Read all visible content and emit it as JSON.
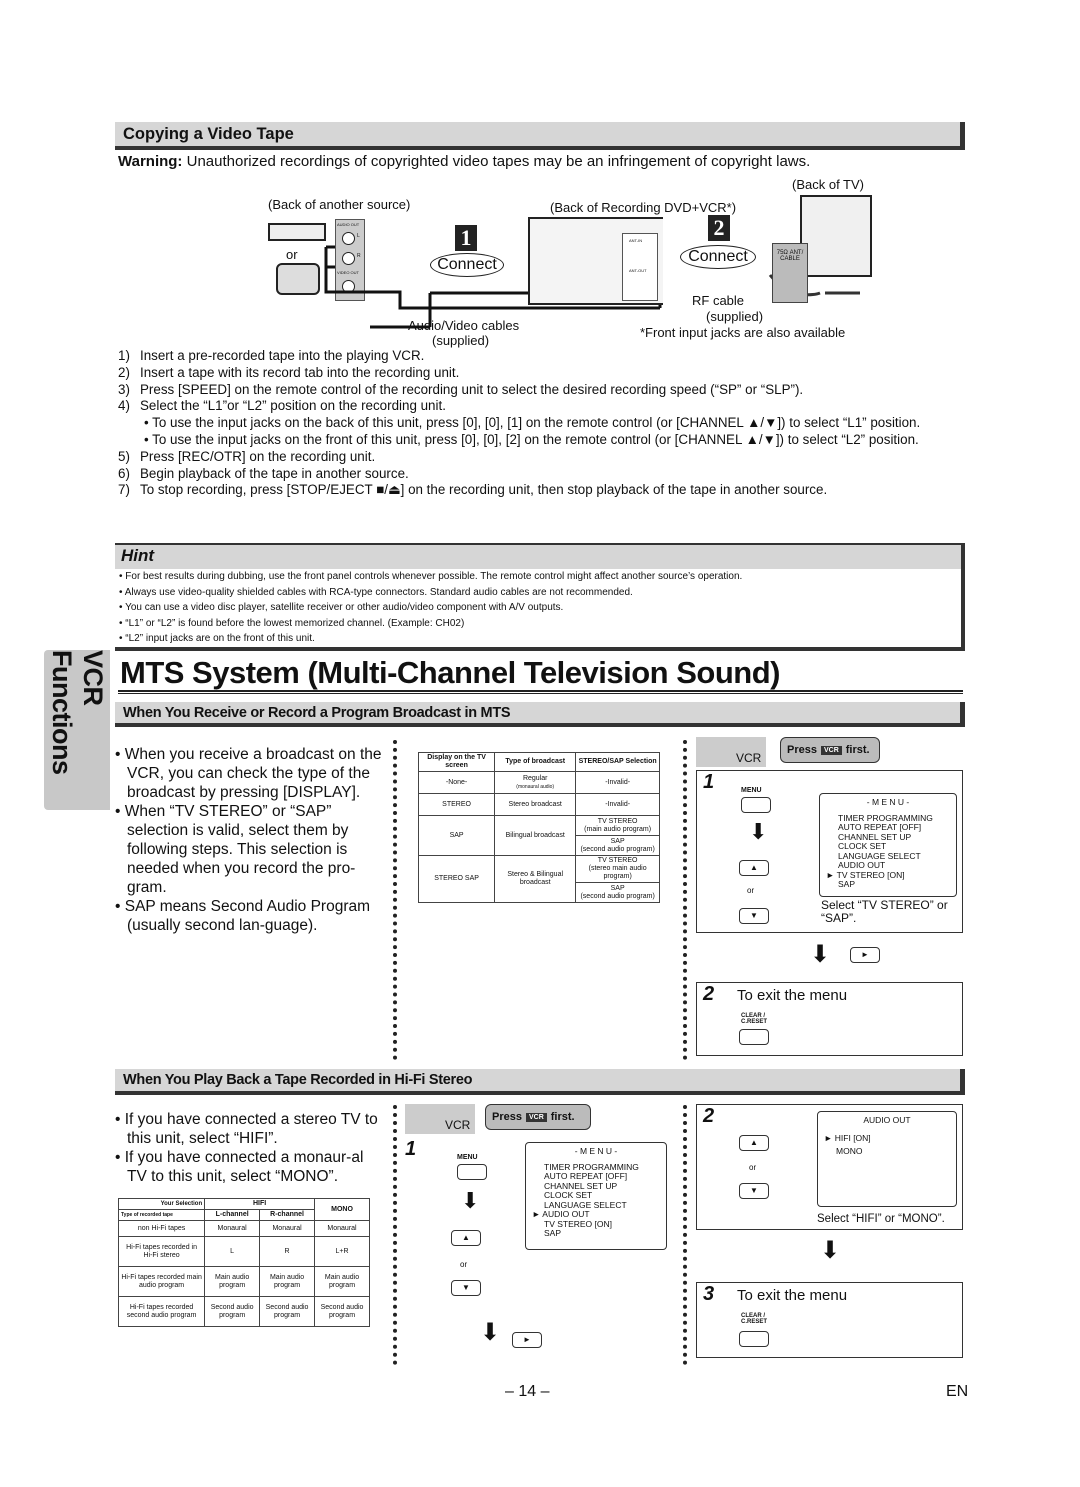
{
  "side_tab": "VCR Functions",
  "copy": {
    "title": "Copying a Video Tape",
    "warning_label": "Warning:",
    "warning_text": " Unauthorized recordings of copyrighted video tapes may be an infringement of copyright laws.",
    "diagram": {
      "back_source": "(Back of another source)",
      "or": "or",
      "audio_out": "AUDIO OUT",
      "l": "L",
      "r": "R",
      "video_out": "VIDEO OUT",
      "connect1_num": "1",
      "connect1": "Connect",
      "av_cables": "Audio/Video cables",
      "supplied": "(supplied)",
      "back_recording": "(Back of Recording DVD+VCR*)",
      "ant_in": "ANT-IN",
      "ant_out": "ANT-OUT",
      "connect2_num": "2",
      "connect2": "Connect",
      "rf_cable": "RF cable",
      "rf_supplied": "(supplied)",
      "back_tv": "(Back of TV)",
      "ant_cable": "75Ω ANT/ CABLE",
      "front_note": "*Front input jacks are also available"
    },
    "steps": [
      {
        "n": "1)",
        "t": "Insert a pre-recorded tape into the playing VCR."
      },
      {
        "n": "2)",
        "t": "Insert a tape with its record tab into the recording unit."
      },
      {
        "n": "3)",
        "t": "Press [SPEED] on the remote control of the recording unit to select the desired recording speed (“SP” or “SLP”)."
      },
      {
        "n": "4)",
        "t": "Select the “L1”or “L2” position on the recording unit."
      },
      {
        "n": "",
        "t": "• To use the input jacks on the back of this unit, press [0], [0], [1] on the remote control (or [CHANNEL ▲/▼]) to select “L1” position."
      },
      {
        "n": "",
        "t": "• To use the input jacks on the front of this unit, press [0], [0], [2] on the remote control (or [CHANNEL ▲/▼]) to select “L2” position."
      },
      {
        "n": "5)",
        "t": "Press [REC/OTR] on the recording unit."
      },
      {
        "n": "6)",
        "t": "Begin playback of the tape in another source."
      },
      {
        "n": "7)",
        "t": "To stop recording, press [STOP/EJECT ■/⏏] on the recording unit, then stop playback of the tape in another source."
      }
    ]
  },
  "hint": {
    "title": "Hint",
    "items": [
      "• For best results during dubbing, use the front panel controls whenever possible. The remote control might affect another source’s operation.",
      "• Always use video-quality shielded cables with RCA-type connectors. Standard audio cables are not recommended.",
      "• You can use a video disc player, satellite receiver or other audio/video component with A/V outputs.",
      "• “L1” or “L2” is found before the lowest memorized channel.  (Example: CH02)",
      "• “L2” input jacks are on the front of this unit."
    ]
  },
  "mts": {
    "title": "MTS System (Multi-Channel Television Sound)",
    "receive": {
      "title": "When You Receive or Record a Program Broadcast in MTS",
      "bullets": [
        "• When you receive a broadcast on the VCR, you can check the type of the broadcast by pressing [DISPLAY].",
        "• When “TV STEREO” or “SAP” selection is valid, select them by following steps. This selection is needed when you record the pro-gram.",
        "• SAP means Second Audio Program (usually second lan-guage)."
      ],
      "table": {
        "headers": [
          "Display on the TV screen",
          "Type of broadcast",
          "STEREO/SAP Selection"
        ],
        "rows": [
          {
            "display": "-None-",
            "type": "Regular",
            "type_note": "(monaural audio)",
            "sel": [
              "-Invalid-"
            ]
          },
          {
            "display": "STEREO",
            "type": "Stereo broadcast",
            "sel": [
              "-Invalid-"
            ]
          },
          {
            "display": "SAP",
            "type": "Bilingual broadcast",
            "sel": [
              "TV STEREO",
              "(main audio program)",
              "SAP",
              "(second audio program)"
            ]
          },
          {
            "display": "STEREO SAP",
            "type": "Stereo & Bilingual broadcast",
            "sel": [
              "TV STEREO",
              "(stereo main audio program)",
              "SAP",
              "(second audio program)"
            ]
          }
        ]
      },
      "vcr": "VCR",
      "press": "Press",
      "vcr_key": "VCR",
      "first": "first.",
      "step1": "1",
      "menu_key": "MENU",
      "or": "or",
      "menu_title": "- M E N U -",
      "menu_items": [
        "TIMER PROGRAMMING",
        "AUTO REPEAT  [OFF]",
        "CHANNEL SET UP",
        "CLOCK SET",
        "LANGUAGE SELECT",
        "AUDIO OUT",
        "►  TV STEREO       [ON]",
        "SAP"
      ],
      "select": "Select “TV STEREO” or “SAP”.",
      "step2": "2",
      "exit": "To exit the menu",
      "clear": "CLEAR / C.RESET"
    },
    "playback": {
      "title": "When You Play Back a Tape Recorded in Hi-Fi Stereo",
      "bullets": [
        "• If you have connected a stereo TV to this unit, select “HIFI”.",
        "• If you have connected a monaur-al TV to this unit, select “MONO”."
      ],
      "table": {
        "your_selection": "Your Selection",
        "type_tape": "Type of recorded tape",
        "hifi": "HIFI",
        "mono": "MONO",
        "lch": "L-channel",
        "rch": "R-channel",
        "rows": [
          [
            "non Hi-Fi tapes",
            "Monaural",
            "Monaural",
            "Monaural"
          ],
          [
            "Hi-Fi tapes recorded in Hi-Fi stereo",
            "L",
            "R",
            "L+R"
          ],
          [
            "Hi-Fi tapes recorded main audio program",
            "Main audio program",
            "Main audio program",
            "Main audio program"
          ],
          [
            "Hi-Fi tapes recorded second audio program",
            "Second audio program",
            "Second audio program",
            "Second audio program"
          ]
        ]
      },
      "vcr": "VCR",
      "press": "Press",
      "vcr_key": "VCR",
      "first": "first.",
      "step1": "1",
      "menu_key": "MENU",
      "or": "or",
      "menu_title": "- M E N U -",
      "menu_items": [
        "TIMER PROGRAMMING",
        "AUTO REPEAT  [OFF]",
        "CHANNEL SET UP",
        "CLOCK SET",
        "LANGUAGE SELECT",
        "►  AUDIO OUT",
        "TV STEREO       [ON]",
        "SAP"
      ],
      "step2": "2",
      "audio_out_title": "AUDIO OUT",
      "audio_items": [
        "►  HIFI                 [ON]",
        "MONO"
      ],
      "select": "Select “HIFI” or “MONO”.",
      "step3": "3",
      "exit": "To exit the menu",
      "clear": "CLEAR / C.RESET"
    }
  },
  "footer": {
    "page": "– 14 –",
    "lang": "EN"
  }
}
